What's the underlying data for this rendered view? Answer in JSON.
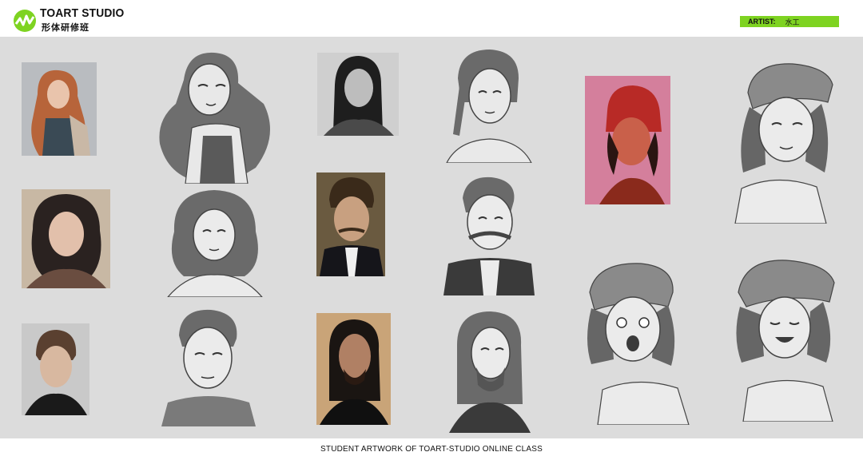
{
  "brand": {
    "name": "TOART STUDIO",
    "subtitle": "形体研修班",
    "accent": "#7ed321"
  },
  "artist": {
    "label": "ARTIST:",
    "name": "水工"
  },
  "footer": {
    "caption": "STUDENT ARTWORK OF TOART-STUDIO ONLINE CLASS"
  },
  "colors": {
    "canvas": "#dcdcdc",
    "badge": "#7ed321"
  },
  "artworks": [
    {
      "reference": "red-haired woman photo",
      "drawing": "woman portrait drawing"
    },
    {
      "reference": "dark-haired woman photo",
      "drawing": "woman portrait drawing"
    },
    {
      "reference": "woman in red beanie photo",
      "drawing": "beanie girl drawing"
    },
    {
      "reference": "curly-haired woman photo",
      "drawing": "curly hair girl drawing"
    },
    {
      "reference": "man with mustache photo",
      "drawing": "mustache man drawing"
    },
    {
      "reference": "young man photo",
      "drawing": "young man drawing"
    },
    {
      "reference": "long-haired man photo",
      "drawing": "bearded man drawing"
    },
    {
      "drawing": "beanie girl shouting drawing"
    },
    {
      "drawing": "beanie girl laughing drawing"
    }
  ]
}
